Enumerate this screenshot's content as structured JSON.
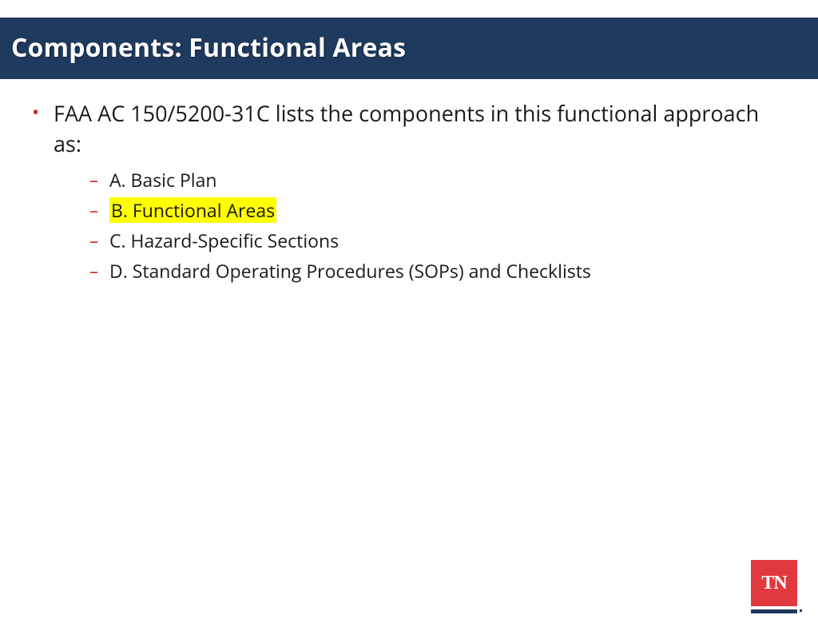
{
  "header": {
    "title": "Components: Functional Areas"
  },
  "content": {
    "mainBullet": "FAA AC 150/5200-31C lists the components in this functional approach as:",
    "subItems": [
      {
        "text": "A. Basic Plan",
        "highlighted": false
      },
      {
        "text": "B. Functional Areas",
        "highlighted": true
      },
      {
        "text": "C. Hazard-Specific Sections",
        "highlighted": false
      },
      {
        "text": "D. Standard Operating Procedures (SOPs) and Checklists",
        "highlighted": false
      }
    ]
  },
  "logo": {
    "text": "TN"
  },
  "colors": {
    "headerBg": "#1f3a5f",
    "bulletAccent": "#d6201f",
    "highlight": "#ffff00",
    "logoBg": "#e03a3e"
  }
}
